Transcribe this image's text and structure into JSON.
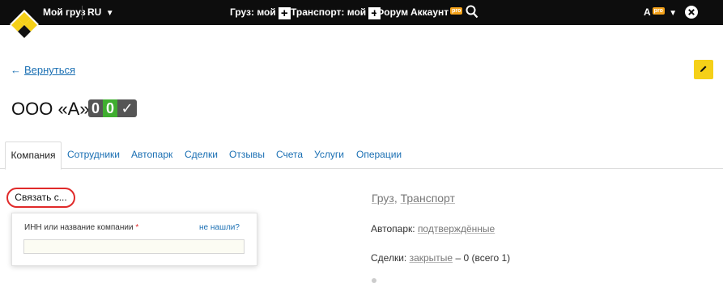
{
  "header": {
    "my_cargo": "Мой груз",
    "lang": "RU",
    "cargo_my": "Груз: мой",
    "transport_my": "Транспорт: мой",
    "forum": "Форум",
    "account": "Аккаунт",
    "pro_badge": "pro",
    "user": "А",
    "user_pro_badge": "pro",
    "plus_glyph": "+",
    "caret_glyph": "▼",
    "icons": [
      "logo-diamond",
      "plus-icon",
      "search-icon",
      "close-icon"
    ]
  },
  "back_link": {
    "arrow": "←",
    "label": "Вернуться"
  },
  "company": {
    "name": "ООО «А»",
    "badge1": "0",
    "badge2": "0",
    "badge3": "✓",
    "colors": {
      "badge_dark": "#555555",
      "badge_green": "#3fad2f"
    }
  },
  "tabs": [
    {
      "label": "Компания",
      "active": true
    },
    {
      "label": "Сотрудники"
    },
    {
      "label": "Автопарк"
    },
    {
      "label": "Сделки"
    },
    {
      "label": "Отзывы"
    },
    {
      "label": "Счета"
    },
    {
      "label": "Услуги"
    },
    {
      "label": "Операции"
    }
  ],
  "connect": {
    "button_label": "Связать с...",
    "field_label": "ИНН или название компании",
    "required_mark": "*",
    "not_found_link": "не нашли?",
    "input_value": ""
  },
  "info": {
    "cargo": "Груз",
    "comma": ", ",
    "transport": "Транспорт",
    "fleet_label": "Автопарк:",
    "fleet_link": "подтверждённые",
    "deals_label": "Сделки:",
    "deals_link": "закрытые",
    "deals_rest": "– 0 (всего 1)"
  },
  "colors": {
    "accent_yellow": "#f5d018",
    "link_blue": "#1a6fb3",
    "highlight_red": "#e02a2a",
    "topbar": "#0d0d0d"
  }
}
